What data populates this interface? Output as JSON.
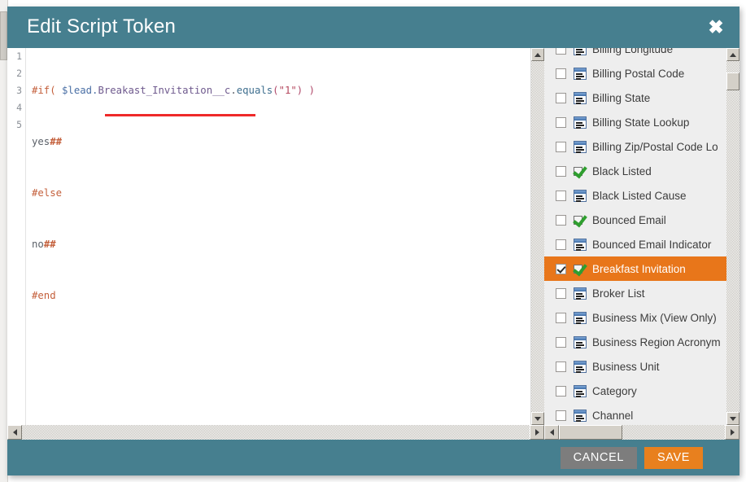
{
  "window": {
    "title": "Edit Script Token",
    "close_icon": "close-icon"
  },
  "editor": {
    "line_numbers": [
      "1",
      "2",
      "3",
      "4",
      "5"
    ],
    "lines": [
      {
        "text": "#if( $lead.Breakast_Invitation__c.equals(\"1\") )"
      },
      {
        "text": "yes##"
      },
      {
        "text": "#else"
      },
      {
        "text": "no##"
      },
      {
        "text": "#end"
      }
    ],
    "tokens": {
      "l1_directive": "#if(",
      "l1_var": " $lead.",
      "l1_field": "Breakast_Invitation__c",
      "l1_dot": ".",
      "l1_method": "equals",
      "l1_open": "(",
      "l1_string": "\"1\"",
      "l1_close": ")",
      "l1_tail": " )",
      "l2_text": "yes",
      "l2_hash": "##",
      "l3_directive": "#else",
      "l4_text": "no",
      "l4_hash": "##",
      "l5_directive": "#end"
    },
    "error_underline_color": "#ef2929"
  },
  "fields": {
    "items": [
      {
        "label": "Billing Longitude",
        "icon": "text-field-icon",
        "checked": false,
        "selected": false
      },
      {
        "label": "Billing Postal Code",
        "icon": "text-field-icon",
        "checked": false,
        "selected": false
      },
      {
        "label": "Billing State",
        "icon": "text-field-icon",
        "checked": false,
        "selected": false
      },
      {
        "label": "Billing State Lookup",
        "icon": "text-field-icon",
        "checked": false,
        "selected": false
      },
      {
        "label": "Billing Zip/Postal Code Lo",
        "icon": "text-field-icon",
        "checked": false,
        "selected": false
      },
      {
        "label": "Black Listed",
        "icon": "boolean-field-icon",
        "checked": false,
        "selected": false
      },
      {
        "label": "Black Listed Cause",
        "icon": "text-field-icon",
        "checked": false,
        "selected": false
      },
      {
        "label": "Bounced Email",
        "icon": "boolean-field-icon",
        "checked": false,
        "selected": false
      },
      {
        "label": "Bounced Email Indicator",
        "icon": "text-field-icon",
        "checked": false,
        "selected": false
      },
      {
        "label": "Breakfast Invitation",
        "icon": "boolean-field-icon",
        "checked": true,
        "selected": true
      },
      {
        "label": "Broker List",
        "icon": "text-field-icon",
        "checked": false,
        "selected": false
      },
      {
        "label": "Business Mix (View Only)",
        "icon": "text-field-icon",
        "checked": false,
        "selected": false
      },
      {
        "label": "Business Region Acronym",
        "icon": "text-field-icon",
        "checked": false,
        "selected": false
      },
      {
        "label": "Business Unit",
        "icon": "text-field-icon",
        "checked": false,
        "selected": false
      },
      {
        "label": "Category",
        "icon": "text-field-icon",
        "checked": false,
        "selected": false
      },
      {
        "label": "Channel",
        "icon": "text-field-icon",
        "checked": false,
        "selected": false
      }
    ],
    "selected_color": "#e8761a"
  },
  "footer": {
    "cancel_label": "CANCEL",
    "save_label": "SAVE",
    "cancel_color": "#7d7d7d",
    "save_color": "#e8801e",
    "bar_color": "#467f8f"
  }
}
